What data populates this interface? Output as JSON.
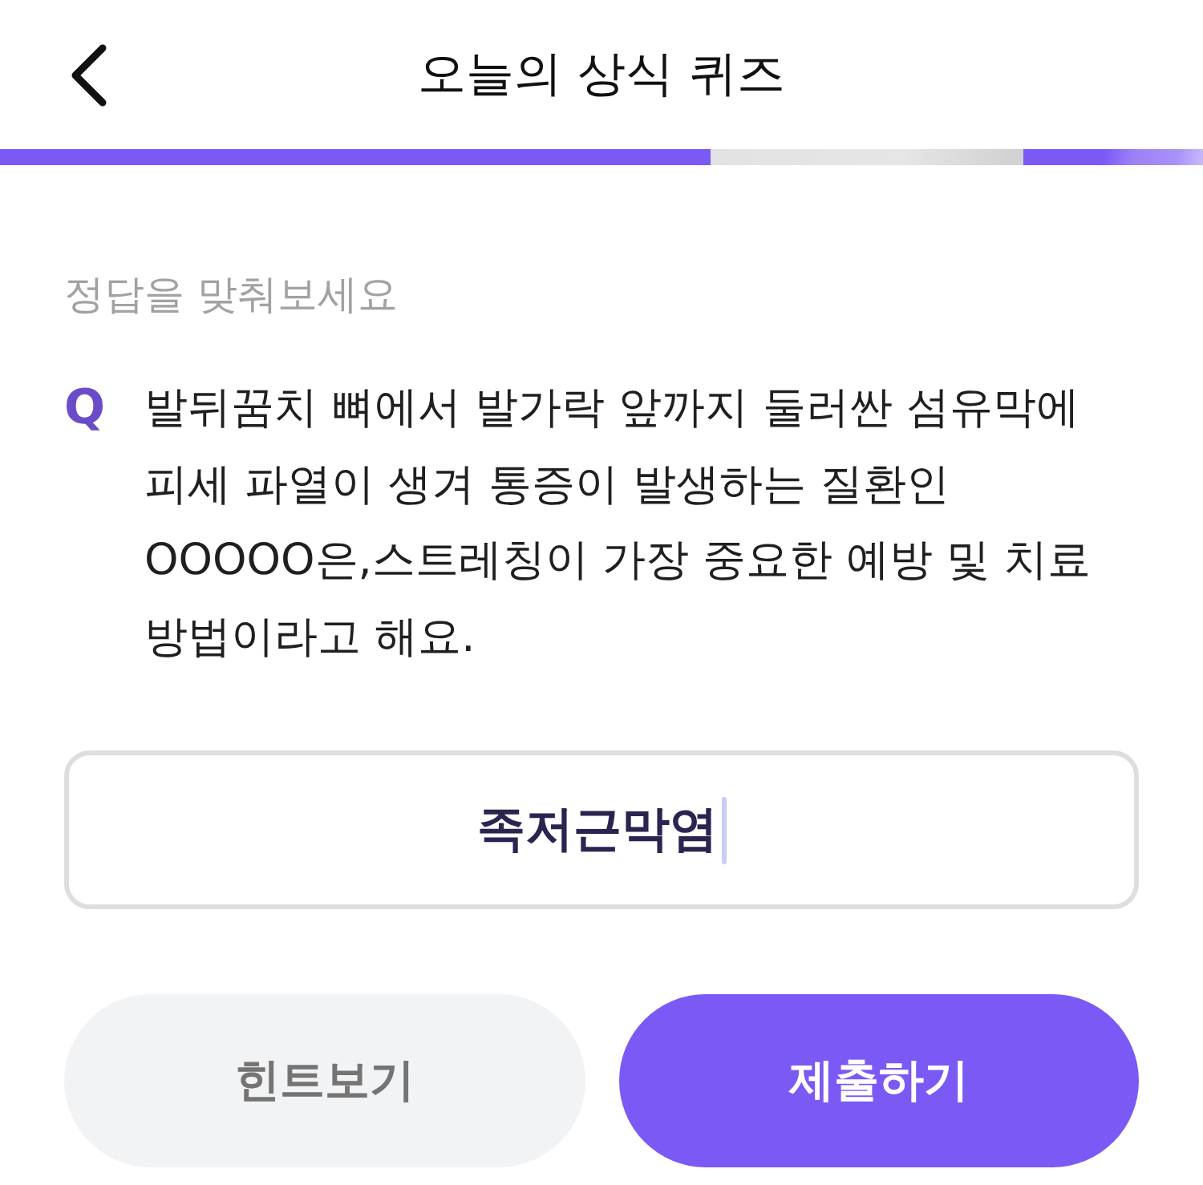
{
  "header": {
    "title": "오늘의 상식 퀴즈"
  },
  "progress": {
    "level": 0.59
  },
  "prompt": "정답을 맞춰보세요",
  "question": {
    "marker": "Q",
    "text": "발뒤꿈치 뼈에서 발가락 앞까지 둘러싼 섬유막에 피세 파열이 생겨 통증이 발생하는 질환인 OOOOO은,스트레칭이 가장 중요한 예방 및 치료 방법이라고 해요."
  },
  "answer": {
    "value": "족저근막염",
    "focused": true
  },
  "buttons": [
    {
      "label": "힌트보기",
      "kind": "secondary"
    },
    {
      "label": "제출하기",
      "kind": "primary"
    }
  ]
}
